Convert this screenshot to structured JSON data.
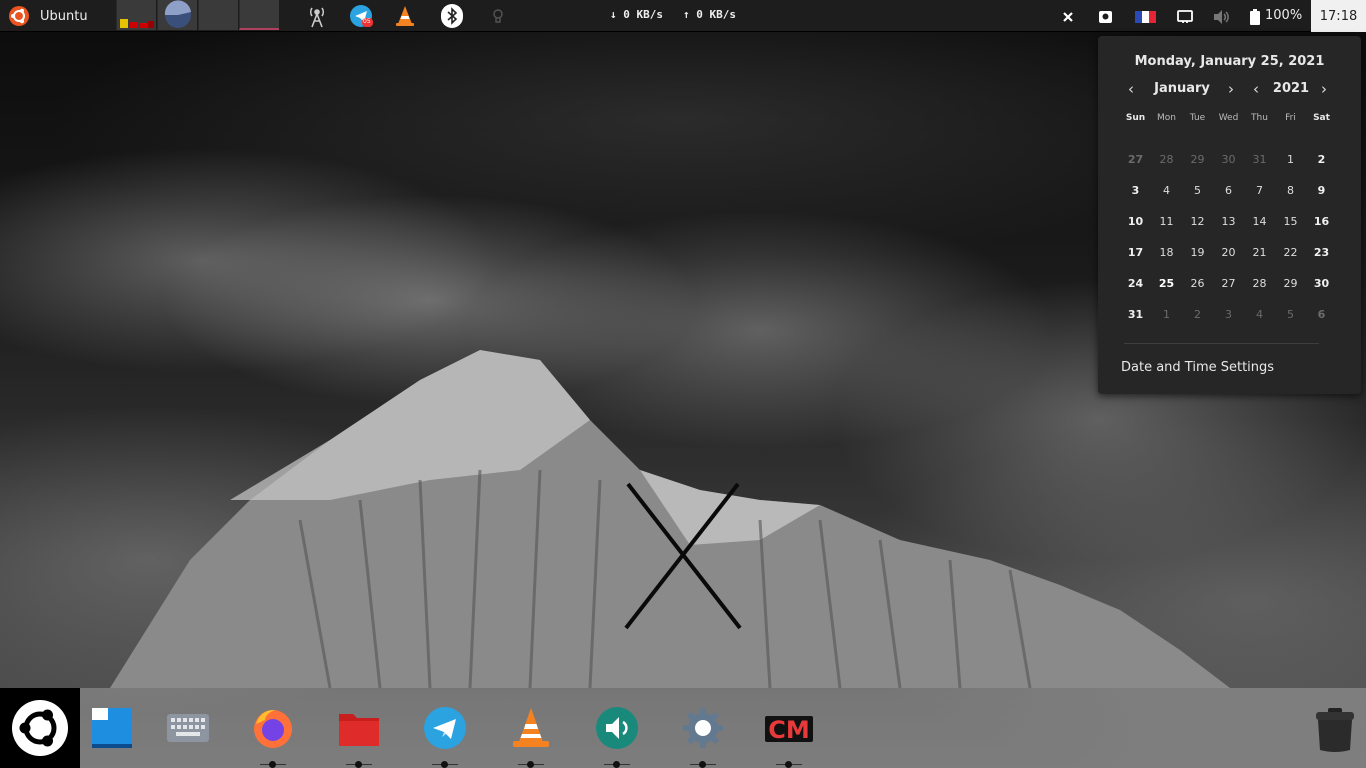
{
  "top_panel": {
    "menu_label": "Ubuntu",
    "net_down": "↓ 0 KB/s",
    "net_up": "↑ 0 KB/s",
    "battery": "100%",
    "clock": "17:18",
    "icons": [
      "ubuntu-logo-icon",
      "system-monitor-icon",
      "pie-monitor-icon",
      "antenna-icon",
      "telegram-icon",
      "vlc-icon",
      "bluetooth-icon",
      "lightbulb-icon",
      "close-icon",
      "screenshot-icon",
      "france-flag-icon",
      "display-icon",
      "volume-icon",
      "battery-icon"
    ],
    "telegram_badge": "05"
  },
  "calendar": {
    "date_heading": "Monday, January 25, 2021",
    "month": "January",
    "year": "2021",
    "weekdays": [
      "Sun",
      "Mon",
      "Tue",
      "Wed",
      "Thu",
      "Fri",
      "Sat"
    ],
    "weeks": [
      [
        "27",
        "28",
        "29",
        "30",
        "31",
        "1",
        "2"
      ],
      [
        "3",
        "4",
        "5",
        "6",
        "7",
        "8",
        "9"
      ],
      [
        "10",
        "11",
        "12",
        "13",
        "14",
        "15",
        "16"
      ],
      [
        "17",
        "18",
        "19",
        "20",
        "21",
        "22",
        "23"
      ],
      [
        "24",
        "25",
        "26",
        "27",
        "28",
        "29",
        "30"
      ],
      [
        "31",
        "1",
        "2",
        "3",
        "4",
        "5",
        "6"
      ]
    ],
    "today": "25",
    "settings_label": "Date and Time Settings",
    "highlight_color": "#3366dd"
  },
  "dock": {
    "items": [
      {
        "name": "ubuntu-menu-icon"
      },
      {
        "name": "notes-icon"
      },
      {
        "name": "keyboard-icon"
      },
      {
        "name": "firefox-icon"
      },
      {
        "name": "files-folder-icon"
      },
      {
        "name": "telegram-icon"
      },
      {
        "name": "vlc-icon"
      },
      {
        "name": "sound-icon"
      },
      {
        "name": "settings-icon"
      },
      {
        "name": "cm-app-icon",
        "label": "CM"
      },
      {
        "name": "trash-icon"
      }
    ]
  }
}
